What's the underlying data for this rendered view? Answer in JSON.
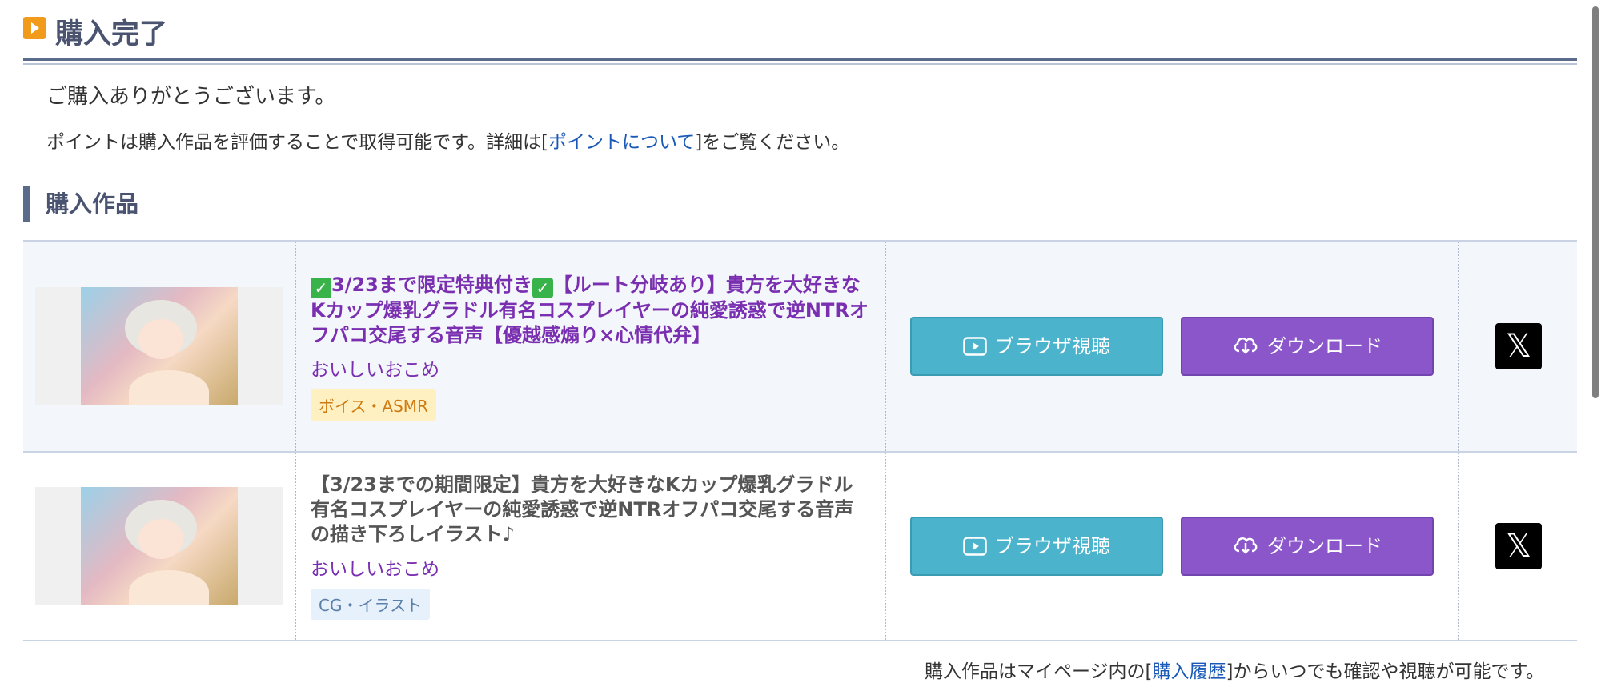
{
  "header": {
    "title": "購入完了"
  },
  "thanks_message": "ご購入ありがとうございます。",
  "points_notice": {
    "before": "ポイントは購入作品を評価することで取得可能です。詳細は[",
    "link": "ポイントについて",
    "after": "]をご覧ください。"
  },
  "section": {
    "title": "購入作品"
  },
  "items": [
    {
      "title_prefix_check": "✓",
      "title_mid_check": "✓",
      "title_part1": "3/23まで限定特典付き",
      "title_part2": "【ルート分岐あり】貴方を大好きなKカップ爆乳グラドル有名コスプレイヤーの純愛誘惑で逆NTRオフパコ交尾する音声【優越感煽り×心情代弁】",
      "circle": "おいしいおこめ",
      "tag": "ボイス・ASMR",
      "browse_label": "ブラウザ視聴",
      "download_label": "ダウンロード",
      "share_icon": "x-logo-icon"
    },
    {
      "title": "【3/23までの期間限定】貴方を大好きなKカップ爆乳グラドル有名コスプレイヤーの純愛誘惑で逆NTRオフパコ交尾する音声の描き下ろしイラスト♪",
      "circle": "おいしいおこめ",
      "tag": "CG・イラスト",
      "browse_label": "ブラウザ視聴",
      "download_label": "ダウンロード",
      "share_icon": "x-logo-icon"
    }
  ],
  "footer": {
    "before": "購入作品はマイページ内の[",
    "link": "購入履歴",
    "after": "]からいつでも確認や視聴が可能です。"
  },
  "colors": {
    "title": "#4a5470",
    "accent_orange": "#f29a1a",
    "browse_button": "#4bb4cc",
    "download_button": "#8a56c9",
    "link": "#1a59b8",
    "item_title_purple": "#7a2fb0"
  }
}
